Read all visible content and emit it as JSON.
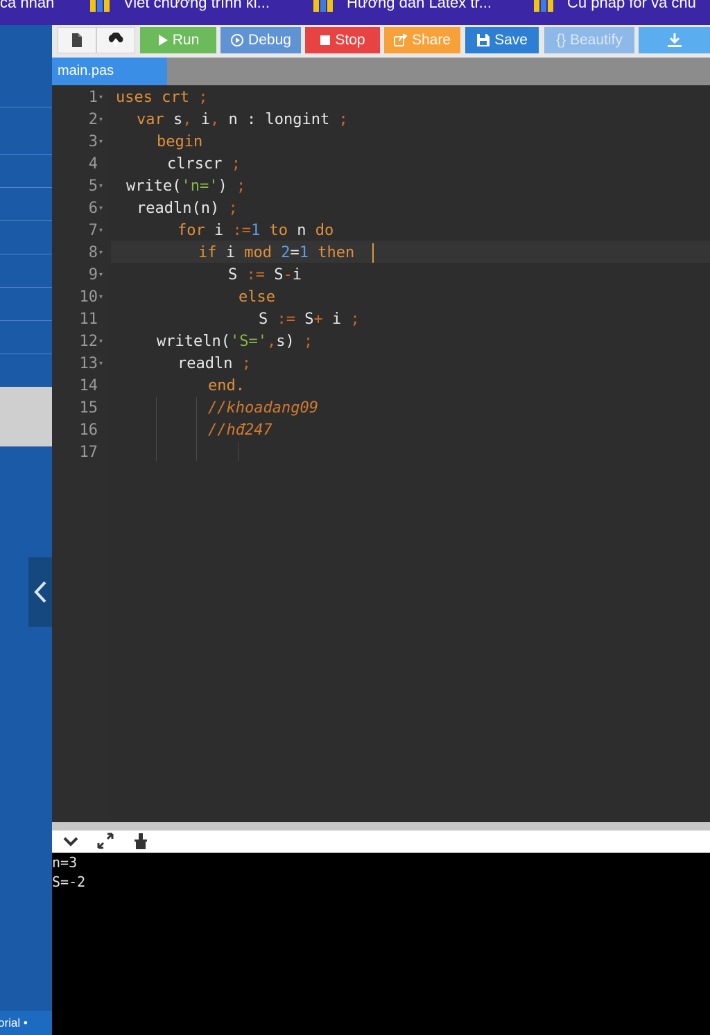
{
  "browser_bookmarks": [
    {
      "label": "cá nhân"
    },
    {
      "label": "Viết chương trình ki..."
    },
    {
      "label": "Hướng dẫn Latex tr..."
    },
    {
      "label": "Cú pháp for và chu"
    }
  ],
  "sidebar": {
    "footer_label": "orial •",
    "toggle_icon": "chevron-left-icon"
  },
  "toolbar": {
    "new_file_icon": "file-icon",
    "upload_icon": "upload-icon",
    "run_label": "Run",
    "debug_label": "Debug",
    "stop_label": "Stop",
    "share_label": "Share",
    "save_label": "Save",
    "beautify_label": "{} Beautify",
    "download_icon": "download-icon"
  },
  "editor": {
    "active_tab": "main.pas",
    "active_line": 8,
    "line_numbers": [
      "1",
      "2",
      "3",
      "4",
      "5",
      "6",
      "7",
      "8",
      "9",
      "10",
      "11",
      "12",
      "13",
      "14",
      "15",
      "16",
      "17"
    ],
    "lines": [
      "uses crt ;",
      "var s, i, n : longint ;",
      "begin",
      "clrscr ;",
      "write('n=') ;",
      "readln(n) ;",
      "for i :=1 to n do",
      "if i mod 2=1 then",
      "S := S-i",
      "else",
      "S := S+ i ;",
      "writeln('S=',s) ;",
      "readln ;",
      "end.",
      "//khoadang09",
      "//hđ247",
      ""
    ]
  },
  "console": {
    "collapse_icon": "chevron-down-icon",
    "expand_icon": "expand-icon",
    "clear_icon": "clear-icon",
    "output": [
      "n=3",
      "S=-2"
    ]
  },
  "colors": {
    "bookmark_bar": "#3b27a5",
    "sidebar": "#1a5aa6",
    "editor_bg": "#2d2d2d",
    "keyword": "#e0903a",
    "string": "#86b84a",
    "number": "#5c9ee6",
    "run": "#6cbb5a",
    "stop": "#e84343",
    "share": "#f7a138",
    "save": "#2d7fd3"
  }
}
